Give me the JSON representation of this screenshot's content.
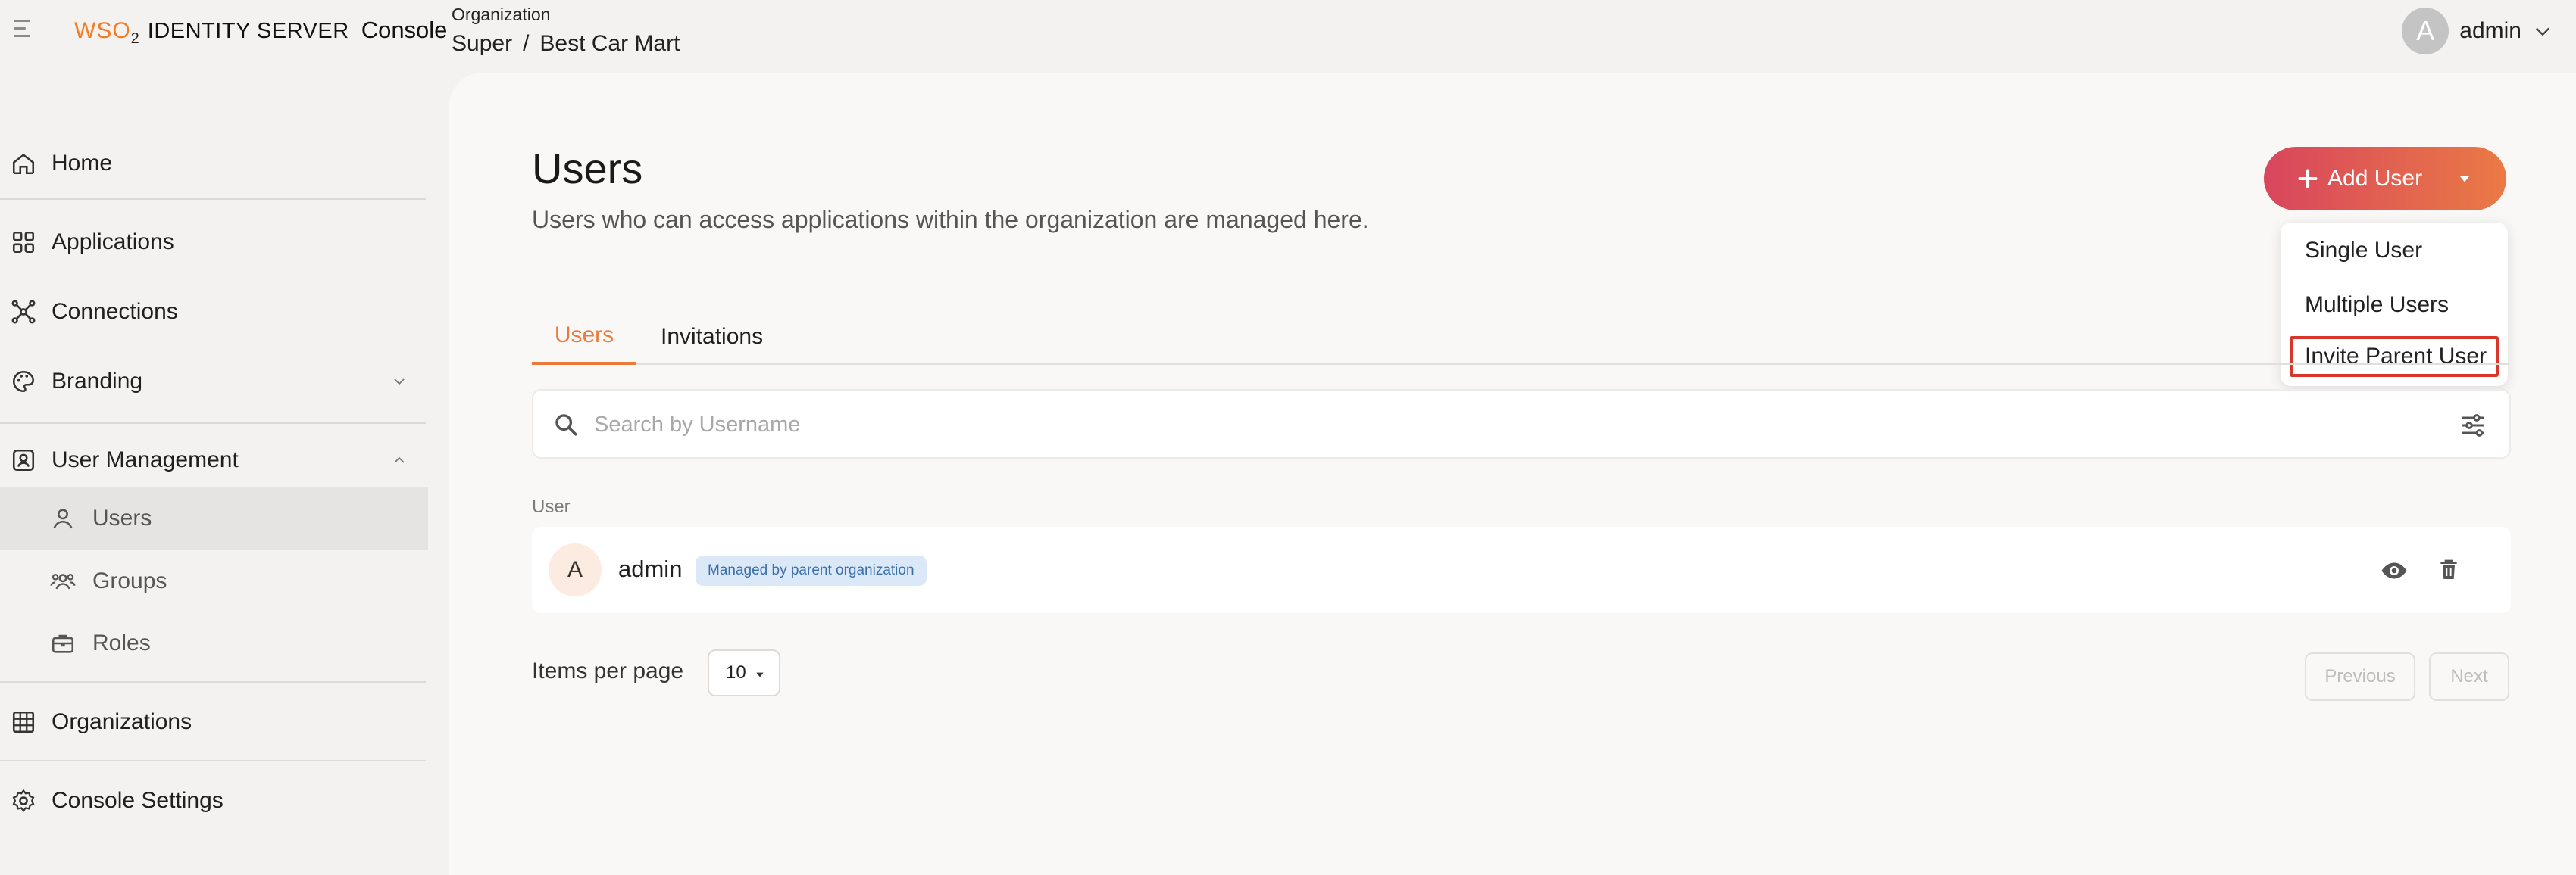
{
  "app": {
    "brand_wso": "WSO",
    "brand_2": "2",
    "brand_product": "IDENTITY SERVER",
    "brand_console": "Console"
  },
  "header": {
    "org_label": "Organization",
    "org_path": [
      "Super",
      "/",
      "Best Car Mart"
    ],
    "user_initial": "A",
    "user_name": "admin"
  },
  "sidebar": {
    "items": [
      {
        "label": "Home",
        "icon": "home-icon"
      },
      {
        "label": "Applications",
        "icon": "applications-icon"
      },
      {
        "label": "Connections",
        "icon": "connections-icon"
      },
      {
        "label": "Branding",
        "icon": "palette-icon"
      },
      {
        "label": "User Management",
        "icon": "user-management-icon"
      },
      {
        "label": "Users",
        "icon": "user-icon"
      },
      {
        "label": "Groups",
        "icon": "groups-icon"
      },
      {
        "label": "Roles",
        "icon": "briefcase-icon"
      },
      {
        "label": "Organizations",
        "icon": "organizations-icon"
      },
      {
        "label": "Console Settings",
        "icon": "gear-icon"
      }
    ]
  },
  "page": {
    "title": "Users",
    "description": "Users who can access applications within the organization are managed here.",
    "add_user_label": "Add User",
    "dropdown": [
      "Single User",
      "Multiple Users",
      "Invite Parent User"
    ],
    "tabs": [
      "Users",
      "Invitations"
    ],
    "search_placeholder": "Search by Username",
    "column_header": "User",
    "rows": [
      {
        "initial": "A",
        "name": "admin",
        "badge": "Managed by parent organization"
      }
    ],
    "items_per_page_label": "Items per page",
    "items_per_page_value": "10",
    "previous_label": "Previous",
    "next_label": "Next"
  },
  "colors": {
    "accent": "#ea7a3b",
    "button_gradient_start": "#d8465d",
    "button_gradient_end": "#ea7a45",
    "highlight_border": "#d9362b",
    "badge_bg": "#dbe8f7",
    "badge_text": "#3a6fa8"
  }
}
